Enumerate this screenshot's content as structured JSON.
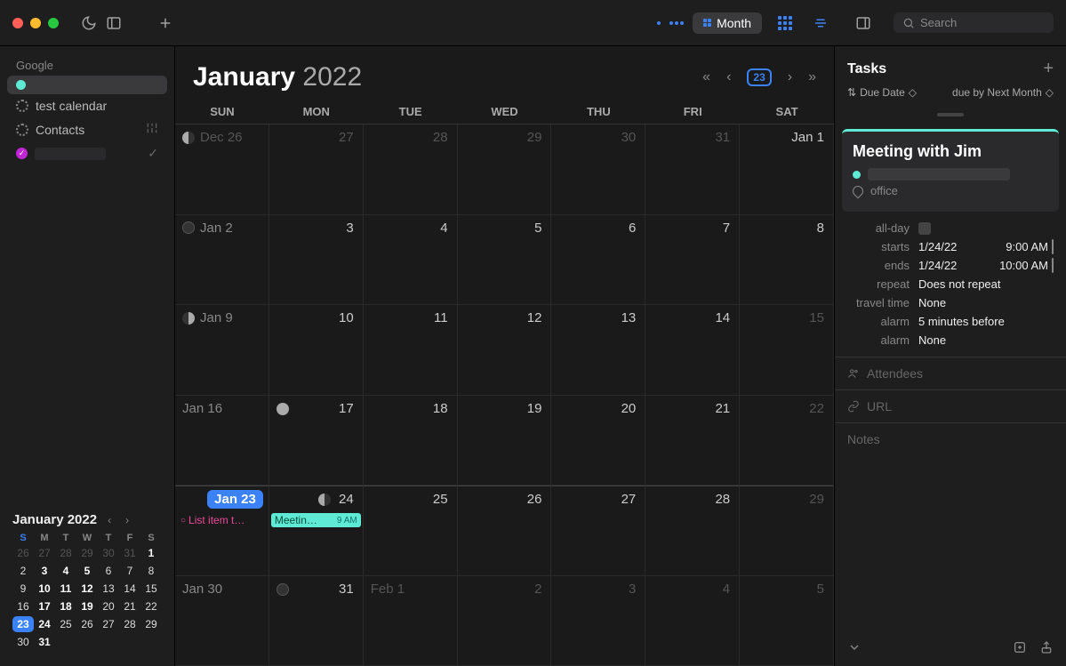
{
  "header": {
    "view_label": "Month",
    "search_placeholder": "Search"
  },
  "sidebar": {
    "group": "Google",
    "items": [
      {
        "label": "",
        "color": "#5eead4",
        "selected": true,
        "kind": "dot"
      },
      {
        "label": "test calendar",
        "kind": "sun"
      },
      {
        "label": "Contacts",
        "kind": "sun"
      },
      {
        "label": "",
        "kind": "check"
      }
    ]
  },
  "calendar": {
    "title_month": "January",
    "title_year": "2022",
    "today_badge": "23",
    "dow": [
      "SUN",
      "MON",
      "TUE",
      "WED",
      "THU",
      "FRI",
      "SAT"
    ],
    "cells": [
      {
        "ml": "Dec 26",
        "dim": true,
        "moon": "last"
      },
      {
        "dn": "27",
        "dim": true
      },
      {
        "dn": "28",
        "dim": true
      },
      {
        "dn": "29",
        "dim": true
      },
      {
        "dn": "30",
        "dim": true
      },
      {
        "dn": "31",
        "dim": true
      },
      {
        "ml": "",
        "dn": "Jan 1"
      },
      {
        "ml": "Jan 2",
        "moon": "new"
      },
      {
        "dn": "3"
      },
      {
        "dn": "4"
      },
      {
        "dn": "5"
      },
      {
        "dn": "6"
      },
      {
        "dn": "7"
      },
      {
        "dn": "8"
      },
      {
        "ml": "Jan 9",
        "moon": "first"
      },
      {
        "dn": "10"
      },
      {
        "dn": "11"
      },
      {
        "dn": "12"
      },
      {
        "dn": "13"
      },
      {
        "dn": "14"
      },
      {
        "dn": "15",
        "dim": true
      },
      {
        "ml": "Jan 16"
      },
      {
        "dn": "17",
        "moon": "full",
        "moonpos": "left"
      },
      {
        "dn": "18"
      },
      {
        "dn": "19"
      },
      {
        "dn": "20"
      },
      {
        "dn": "21"
      },
      {
        "dn": "22",
        "dim": true
      },
      {
        "today": "Jan 23",
        "ev_pink": "List item t…"
      },
      {
        "dn": "24",
        "ev_teal": "Meetin…",
        "ev_time": "9 AM",
        "moon": "last",
        "moonpos": "right"
      },
      {
        "dn": "25"
      },
      {
        "dn": "26"
      },
      {
        "dn": "27"
      },
      {
        "dn": "28"
      },
      {
        "dn": "29",
        "dim": true
      },
      {
        "ml": "Jan 30"
      },
      {
        "dn": "31",
        "moon": "new",
        "moonpos": "left"
      },
      {
        "ml": "Feb 1",
        "dim": true
      },
      {
        "dn": "2",
        "dim": true
      },
      {
        "dn": "3",
        "dim": true
      },
      {
        "dn": "4",
        "dim": true
      },
      {
        "dn": "5",
        "dim": true
      }
    ]
  },
  "mini": {
    "title": "January 2022",
    "dow": [
      "S",
      "M",
      "T",
      "W",
      "T",
      "F",
      "S"
    ],
    "days": [
      {
        "n": "26",
        "dim": true
      },
      {
        "n": "27",
        "dim": true
      },
      {
        "n": "28",
        "dim": true
      },
      {
        "n": "29",
        "dim": true
      },
      {
        "n": "30",
        "dim": true
      },
      {
        "n": "31",
        "dim": true
      },
      {
        "n": "1",
        "bold": true
      },
      {
        "n": "2"
      },
      {
        "n": "3",
        "bold": true
      },
      {
        "n": "4",
        "bold": true
      },
      {
        "n": "5",
        "bold": true
      },
      {
        "n": "6"
      },
      {
        "n": "7"
      },
      {
        "n": "8"
      },
      {
        "n": "9"
      },
      {
        "n": "10",
        "bold": true
      },
      {
        "n": "11",
        "bold": true
      },
      {
        "n": "12",
        "bold": true
      },
      {
        "n": "13"
      },
      {
        "n": "14"
      },
      {
        "n": "15"
      },
      {
        "n": "16"
      },
      {
        "n": "17",
        "bold": true
      },
      {
        "n": "18",
        "bold": true
      },
      {
        "n": "19",
        "bold": true
      },
      {
        "n": "20"
      },
      {
        "n": "21"
      },
      {
        "n": "22"
      },
      {
        "n": "23",
        "today": true
      },
      {
        "n": "24",
        "bold": true
      },
      {
        "n": "25"
      },
      {
        "n": "26"
      },
      {
        "n": "27"
      },
      {
        "n": "28"
      },
      {
        "n": "29"
      },
      {
        "n": "30"
      },
      {
        "n": "31",
        "bold": true
      }
    ]
  },
  "tasks": {
    "title": "Tasks",
    "sort1": "Due Date",
    "sort2": "due by Next Month"
  },
  "event": {
    "title": "Meeting with Jim",
    "location": "office",
    "rows": {
      "allday_label": "all-day",
      "starts_label": "starts",
      "starts_date": "1/24/22",
      "starts_time": "9:00 AM",
      "ends_label": "ends",
      "ends_date": "1/24/22",
      "ends_time": "10:00 AM",
      "repeat_label": "repeat",
      "repeat_value": "Does not repeat",
      "travel_label": "travel time",
      "travel_value": "None",
      "alarm1_label": "alarm",
      "alarm1_value": "5 minutes before",
      "alarm2_label": "alarm",
      "alarm2_value": "None"
    },
    "attendees": "Attendees",
    "url": "URL",
    "notes": "Notes"
  }
}
